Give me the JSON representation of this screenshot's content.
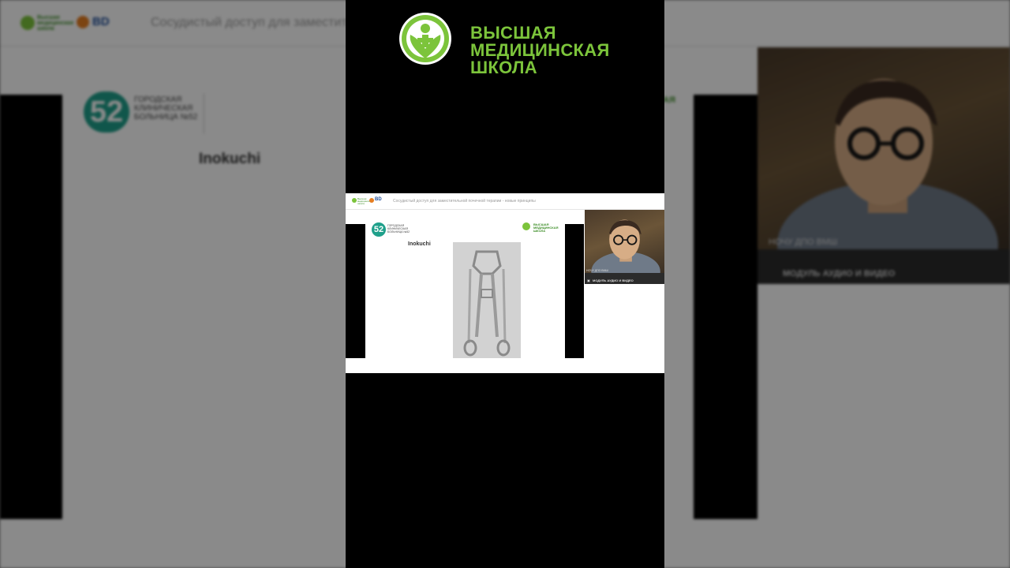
{
  "background": {
    "header": {
      "logo_school_text": "Высшая медицинская школа",
      "logo_bd_text": "BD",
      "title": "Сосудистый доступ для заместит"
    },
    "slide": {
      "hospital_name": "ГОРОДСКАЯ КЛИНИЧЕСКАЯ БОЛЬНИЦА №52",
      "hospital_number": "52",
      "title": "Inokuchi",
      "partner_text": "АЯ"
    },
    "webcam": {
      "label": "НОЧУ ДПО ВМШ",
      "module_label": "МОДУЛЬ АУДИО И ВИДЕО"
    }
  },
  "brand": {
    "line1": "ВЫСШАЯ",
    "line2": "МЕДИЦИНСКАЯ",
    "line3": "ШКОЛА"
  },
  "screen": {
    "header": {
      "logo_school_text": "Высшая медицинская школа",
      "logo_bd_text": "BD",
      "title": "Сосудистый доступ для заместительной почечной терапии - новые принципы"
    },
    "slide": {
      "hospital_number": "52",
      "hospital_name": "ГОРОДСКАЯ КЛИНИЧЕСКАЯ БОЛЬНИЦА №52",
      "partner_text": "ВЫСШАЯ МЕДИЦИНСКАЯ ШКОЛА",
      "title": "Inokuchi"
    },
    "webcam": {
      "label": "НОЧУ ДПО ВМШ",
      "module_label": "МОДУЛЬ АУДИО И ВИДЕО"
    }
  },
  "colors": {
    "brand_green": "#7cc43b",
    "hospital_teal": "#1fa08b",
    "bd_blue": "#1f4e9a",
    "bd_orange": "#e67e22"
  }
}
